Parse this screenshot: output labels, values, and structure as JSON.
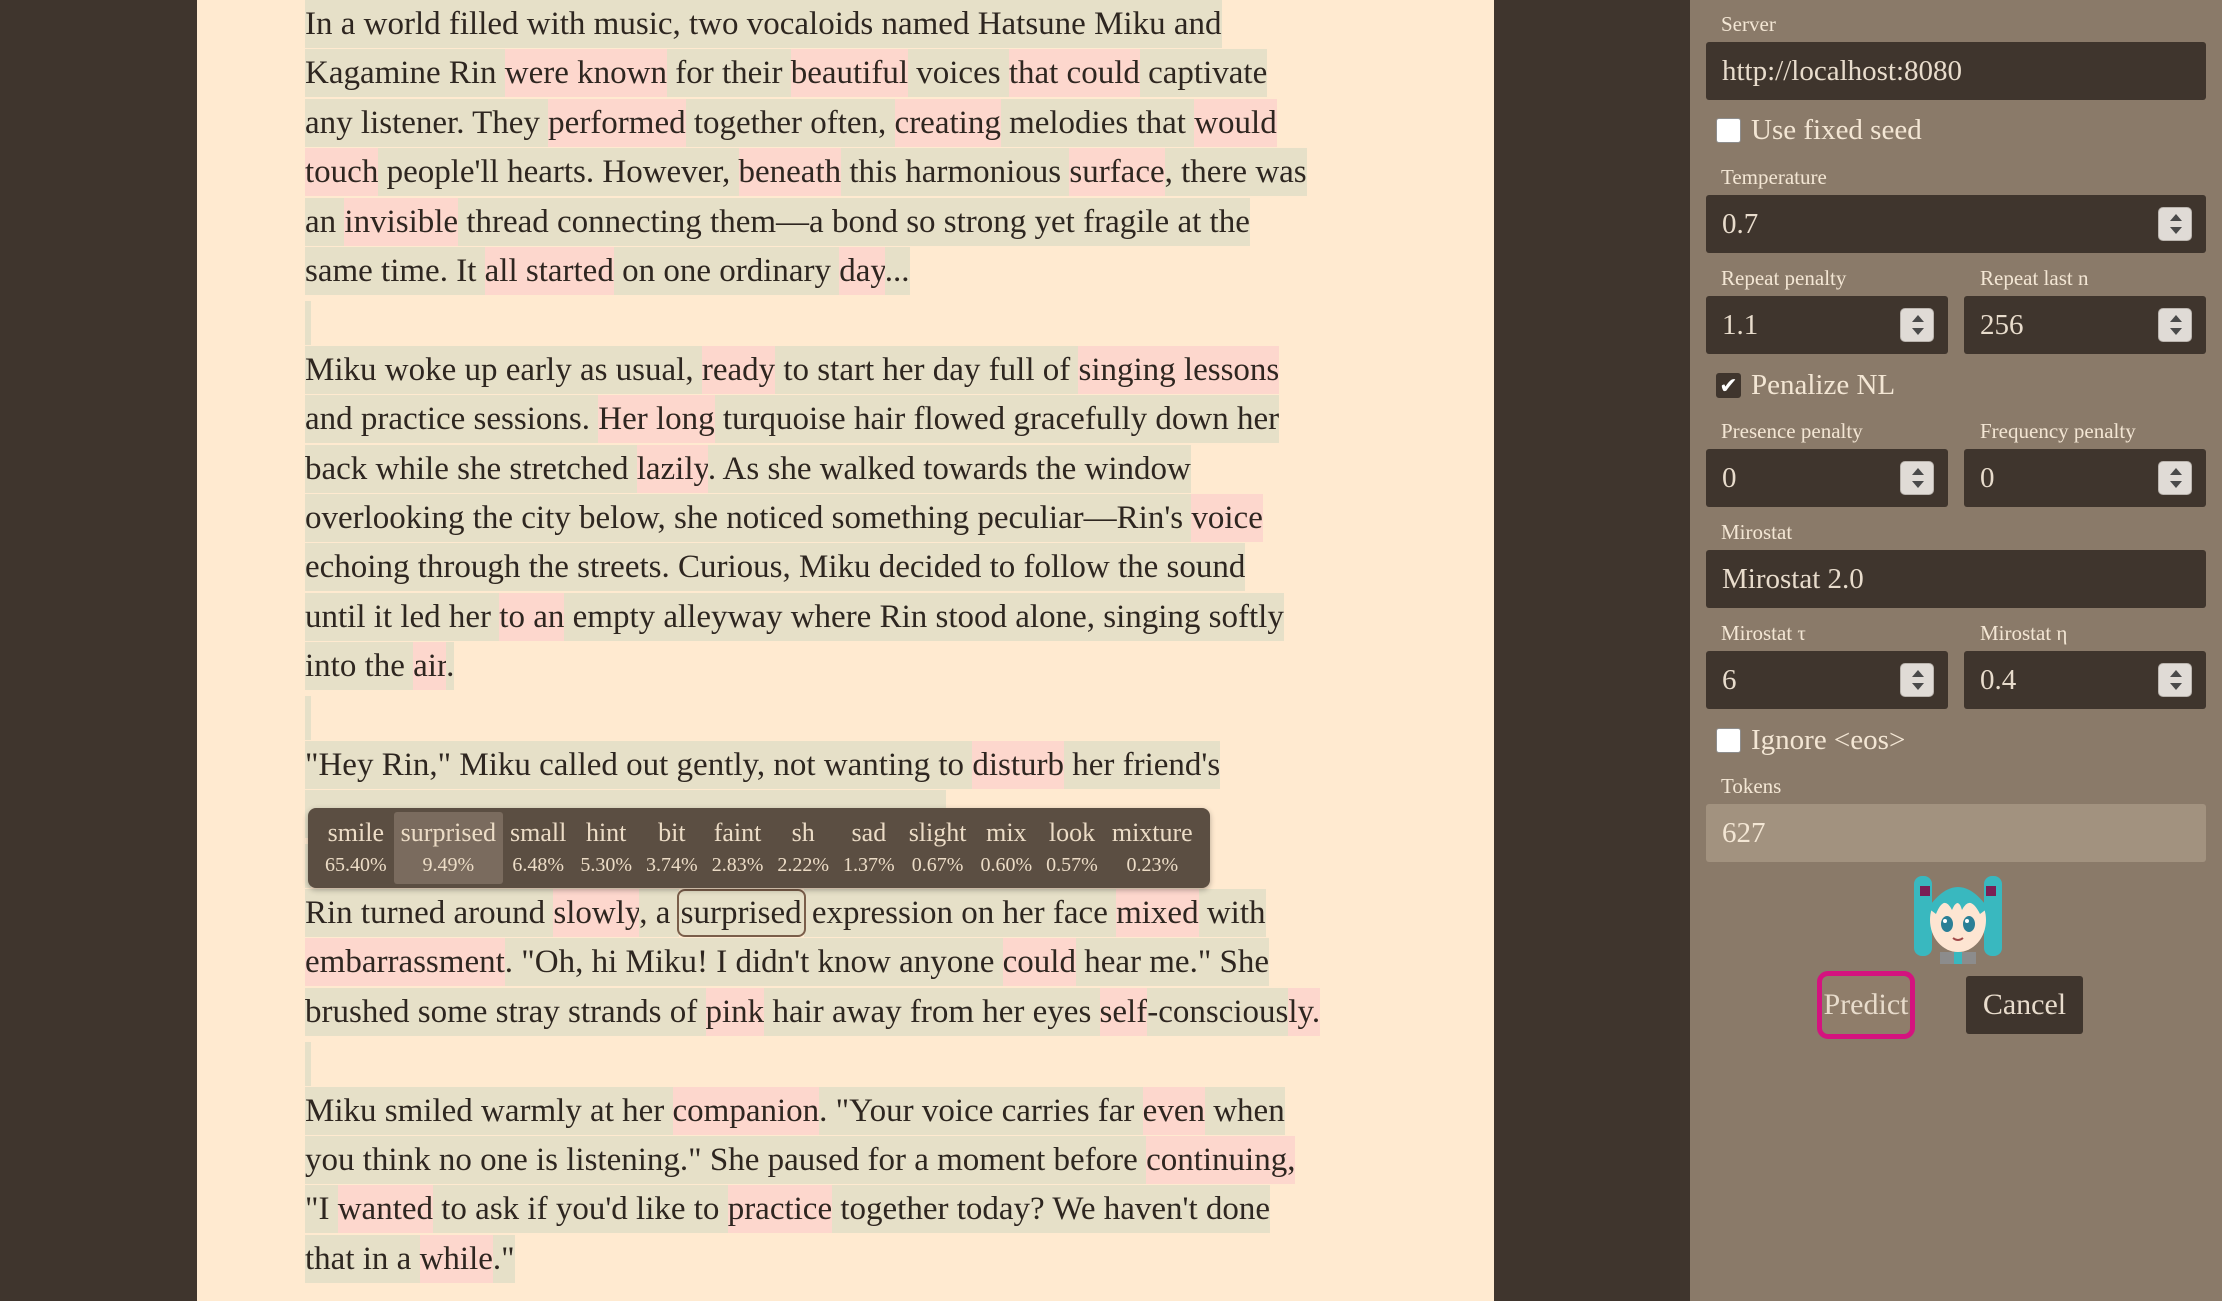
{
  "story": {
    "lines": [
      [
        [
          "g",
          " In a world filled with music, two vocaloids named Hatsune Miku and"
        ]
      ],
      [
        [
          "g",
          "Kagamine Rin "
        ],
        [
          "p",
          "were known"
        ],
        [
          "g",
          " for their "
        ],
        [
          "p",
          "beautiful"
        ],
        [
          "g",
          " voices "
        ],
        [
          "p",
          "that could"
        ],
        [
          "g",
          " captivate"
        ]
      ],
      [
        [
          "g",
          "any listener. They "
        ],
        [
          "p",
          "performed"
        ],
        [
          "g",
          " together often, "
        ],
        [
          "p",
          "creating"
        ],
        [
          "g",
          " melodies that "
        ],
        [
          "p",
          "would"
        ]
      ],
      [
        [
          "p",
          "touch"
        ],
        [
          "g",
          " people'll hearts. However, "
        ],
        [
          "p",
          "beneath"
        ],
        [
          "g",
          " this harmonious "
        ],
        [
          "p",
          "surface"
        ],
        [
          "g",
          ", there was"
        ]
      ],
      [
        [
          "g",
          "an "
        ],
        [
          "p",
          "invisible"
        ],
        [
          "g",
          " thread connecting them—a bond so strong yet fragile at the"
        ]
      ],
      [
        [
          "g",
          "same time. It "
        ],
        [
          "p",
          "all started"
        ],
        [
          "g",
          " on one ordinary "
        ],
        [
          "p",
          "day"
        ],
        [
          "g",
          "..."
        ]
      ],
      [],
      [
        [
          "g",
          "Miku woke up early as usual, "
        ],
        [
          "p",
          "ready"
        ],
        [
          "g",
          " to start her day full of "
        ],
        [
          "p",
          "singing lessons"
        ]
      ],
      [
        [
          "g",
          "and practice sessions. "
        ],
        [
          "p",
          "Her long"
        ],
        [
          "g",
          " turquoise hair flowed gracefully down her"
        ]
      ],
      [
        [
          "g",
          "back while she stretched "
        ],
        [
          "p",
          "lazily"
        ],
        [
          "g",
          ". As she walked towards the window"
        ]
      ],
      [
        [
          "g",
          "overlooking the city below, she noticed something peculiar—Rin's "
        ],
        [
          "p",
          "voice"
        ]
      ],
      [
        [
          "g",
          "echoing through the streets. Curious, Miku decided to follow the sound"
        ]
      ],
      [
        [
          "g",
          "until it led her "
        ],
        [
          "p",
          "to an"
        ],
        [
          "g",
          " empty alleyway where Rin stood alone, singing softly"
        ]
      ],
      [
        [
          "g",
          "into the "
        ],
        [
          "p",
          "air"
        ],
        [
          "g",
          "."
        ]
      ],
      [],
      [
        [
          "g",
          "\"Hey Rin,\" Miku called out gently, not wanting to "
        ],
        [
          "p",
          "disturb"
        ],
        [
          "g",
          " her friend's"
        ]
      ],
      [
        [
          "g",
          "moment of solitude. \"What are you doing here?\""
        ]
      ],
      [],
      [
        [
          "g",
          "Rin turned around "
        ],
        [
          "p",
          "slowly"
        ],
        [
          "g",
          ", a "
        ],
        [
          "s",
          "surprised"
        ],
        [
          "g",
          " expression on her face "
        ],
        [
          "p",
          "mixed"
        ],
        [
          "g",
          " with"
        ]
      ],
      [
        [
          "p",
          "embarrassment"
        ],
        [
          "g",
          ". \"Oh, hi Miku! I didn't know anyone "
        ],
        [
          "p",
          "could"
        ],
        [
          "g",
          " hear me.\" She"
        ]
      ],
      [
        [
          "g",
          "brushed some stray strands of "
        ],
        [
          "p",
          "pink"
        ],
        [
          "g",
          " hair away from her eyes "
        ],
        [
          "p",
          "self"
        ],
        [
          "g",
          "-conscious"
        ],
        [
          "p",
          "ly."
        ]
      ],
      [],
      [
        [
          "g",
          "Miku smiled warmly at her "
        ],
        [
          "p",
          "companion"
        ],
        [
          "g",
          ". \"Your voice carries far "
        ],
        [
          "p",
          "even"
        ],
        [
          "g",
          " when"
        ]
      ],
      [
        [
          "g",
          "you think no one is listening.\" She paused for a moment before "
        ],
        [
          "p",
          "continuing,"
        ]
      ],
      [
        [
          "g",
          "\"I "
        ],
        [
          "p",
          "wanted"
        ],
        [
          "g",
          " to ask if you'd like to "
        ],
        [
          "p",
          "practice"
        ],
        [
          "g",
          " together today? We haven't done"
        ]
      ],
      [
        [
          "g",
          "that in a "
        ],
        [
          "p",
          "while"
        ],
        [
          "g",
          ".\""
        ]
      ]
    ]
  },
  "tooltip": {
    "items": [
      {
        "word": "smile",
        "pct": "65.40%",
        "active": false
      },
      {
        "word": "surprised",
        "pct": "9.49%",
        "active": true
      },
      {
        "word": "small",
        "pct": "6.48%",
        "active": false
      },
      {
        "word": "hint",
        "pct": "5.30%",
        "active": false
      },
      {
        "word": "bit",
        "pct": "3.74%",
        "active": false
      },
      {
        "word": "faint",
        "pct": "2.83%",
        "active": false
      },
      {
        "word": "sh",
        "pct": "2.22%",
        "active": false
      },
      {
        "word": "sad",
        "pct": "1.37%",
        "active": false
      },
      {
        "word": "slight",
        "pct": "0.67%",
        "active": false
      },
      {
        "word": "mix",
        "pct": "0.60%",
        "active": false
      },
      {
        "word": "look",
        "pct": "0.57%",
        "active": false
      },
      {
        "word": "mixture",
        "pct": "0.23%",
        "active": false
      }
    ]
  },
  "settings": {
    "server_label": "Server",
    "server_value": "http://localhost:8080",
    "fixed_seed_label": "Use fixed seed",
    "temperature_label": "Temperature",
    "temperature_value": "0.7",
    "repeat_penalty_label": "Repeat penalty",
    "repeat_penalty_value": "1.1",
    "repeat_last_n_label": "Repeat last n",
    "repeat_last_n_value": "256",
    "penalize_nl_label": "Penalize NL",
    "presence_penalty_label": "Presence penalty",
    "presence_penalty_value": "0",
    "frequency_penalty_label": "Frequency penalty",
    "frequency_penalty_value": "0",
    "mirostat_label": "Mirostat",
    "mirostat_value": "Mirostat 2.0",
    "mirostat_tau_label": "Mirostat τ",
    "mirostat_tau_value": "6",
    "mirostat_eta_label": "Mirostat η",
    "mirostat_eta_value": "0.4",
    "ignore_eos_label": "Ignore <eos>",
    "tokens_label": "Tokens",
    "tokens_value": "627",
    "predict_label": "Predict",
    "cancel_label": "Cancel"
  }
}
